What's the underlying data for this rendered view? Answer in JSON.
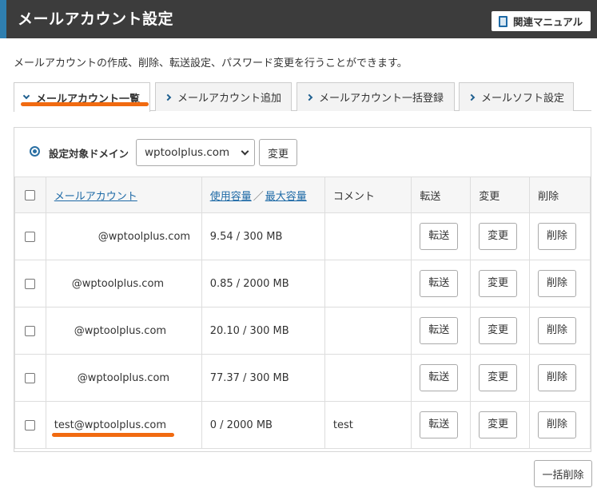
{
  "header": {
    "title": "メールアカウント設定",
    "manual_label": "関連マニュアル",
    "manual_icon": "book-icon",
    "accent_color": "#2f7fb0",
    "bar_color": "#3c3c3c"
  },
  "description": "メールアカウントの作成、削除、転送設定、パスワード変更を行うことができます。",
  "tabs": [
    {
      "label": "メールアカウント一覧",
      "active": true
    },
    {
      "label": "メールアカウント追加",
      "active": false
    },
    {
      "label": "メールアカウント一括登録",
      "active": false
    },
    {
      "label": "メールソフト設定",
      "active": false
    }
  ],
  "domain": {
    "label": "設定対象ドメイン",
    "selected": "wptoolplus.com",
    "change_label": "変更"
  },
  "table": {
    "headers": {
      "account": "メールアカウント",
      "usage": "使用容量",
      "separator": "／",
      "max": "最大容量",
      "comment": "コメント",
      "forward": "転送",
      "change": "変更",
      "delete": "削除"
    },
    "rows": [
      {
        "email": "@wptoolplus.com",
        "usage": "9.54 / 300 MB",
        "comment": "",
        "forward": "転送",
        "change": "変更",
        "delete": "削除"
      },
      {
        "email": "@wptoolplus.com",
        "usage": "0.85 / 2000 MB",
        "comment": "",
        "forward": "転送",
        "change": "変更",
        "delete": "削除"
      },
      {
        "email": "@wptoolplus.com",
        "usage": "20.10 / 300 MB",
        "comment": "",
        "forward": "転送",
        "change": "変更",
        "delete": "削除"
      },
      {
        "email": "@wptoolplus.com",
        "usage": "77.37 / 300 MB",
        "comment": "",
        "forward": "転送",
        "change": "変更",
        "delete": "削除"
      },
      {
        "email": "test@wptoolplus.com",
        "usage": "0 / 2000 MB",
        "comment": "test",
        "forward": "転送",
        "change": "変更",
        "delete": "削除"
      }
    ]
  },
  "bulk_delete_label": "一括削除",
  "highlight_color": "#f16a10"
}
